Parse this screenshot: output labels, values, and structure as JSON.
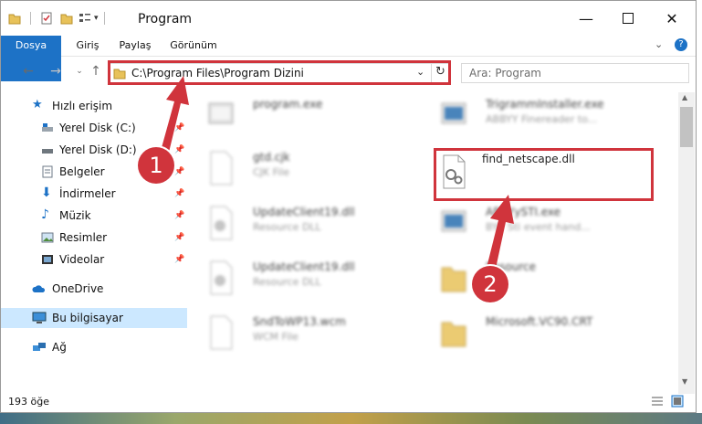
{
  "window": {
    "title": "Program"
  },
  "ribbon": {
    "tabs": [
      "Dosya",
      "Giriş",
      "Paylaş",
      "Görünüm"
    ]
  },
  "address": {
    "path": "C:\\Program Files\\Program Dizini"
  },
  "search": {
    "placeholder": "Ara: Program"
  },
  "sidebar": {
    "items": [
      {
        "label": "Hızlı erişim",
        "icon": "star-icon"
      },
      {
        "label": "Yerel Disk (C:)",
        "icon": "drive-icon"
      },
      {
        "label": "Yerel Disk (D:)",
        "icon": "drive-icon"
      },
      {
        "label": "Belgeler",
        "icon": "documents-icon"
      },
      {
        "label": "İndirmeler",
        "icon": "download-icon"
      },
      {
        "label": "Müzik",
        "icon": "music-icon"
      },
      {
        "label": "Resimler",
        "icon": "pictures-icon"
      },
      {
        "label": "Videolar",
        "icon": "videos-icon"
      },
      {
        "label": "OneDrive",
        "icon": "cloud-icon"
      },
      {
        "label": "Bu bilgisayar",
        "icon": "computer-icon"
      },
      {
        "label": "Ağ",
        "icon": "network-icon"
      }
    ]
  },
  "files": {
    "left": [
      {
        "name": "program.exe",
        "desc": ""
      },
      {
        "name": "gtd.cjk",
        "desc": "CJK File"
      },
      {
        "name": "UpdateClient19.dll",
        "desc": "Resource DLL"
      },
      {
        "name": "UpdateClient19.dll",
        "desc": "Resource DLL"
      },
      {
        "name": "SndToWP13.wcm",
        "desc": "WCM File"
      }
    ],
    "right": [
      {
        "name": "TrigrammInstaller.exe",
        "desc": "ABBYY Finereader to..."
      },
      {
        "name": "find_netscape.dll",
        "desc": ""
      },
      {
        "name": "ABBYySTI.exe",
        "desc": "BYY Sti event hand..."
      },
      {
        "name": "Resource",
        "desc": ""
      },
      {
        "name": "Microsoft.VC90.CRT",
        "desc": ""
      }
    ]
  },
  "status": {
    "count": "193 öğe"
  },
  "annotations": {
    "step1": "1",
    "step2": "2"
  },
  "colors": {
    "accent": "#1d72c6",
    "highlight": "#d0343c",
    "selected": "#cce8ff"
  }
}
